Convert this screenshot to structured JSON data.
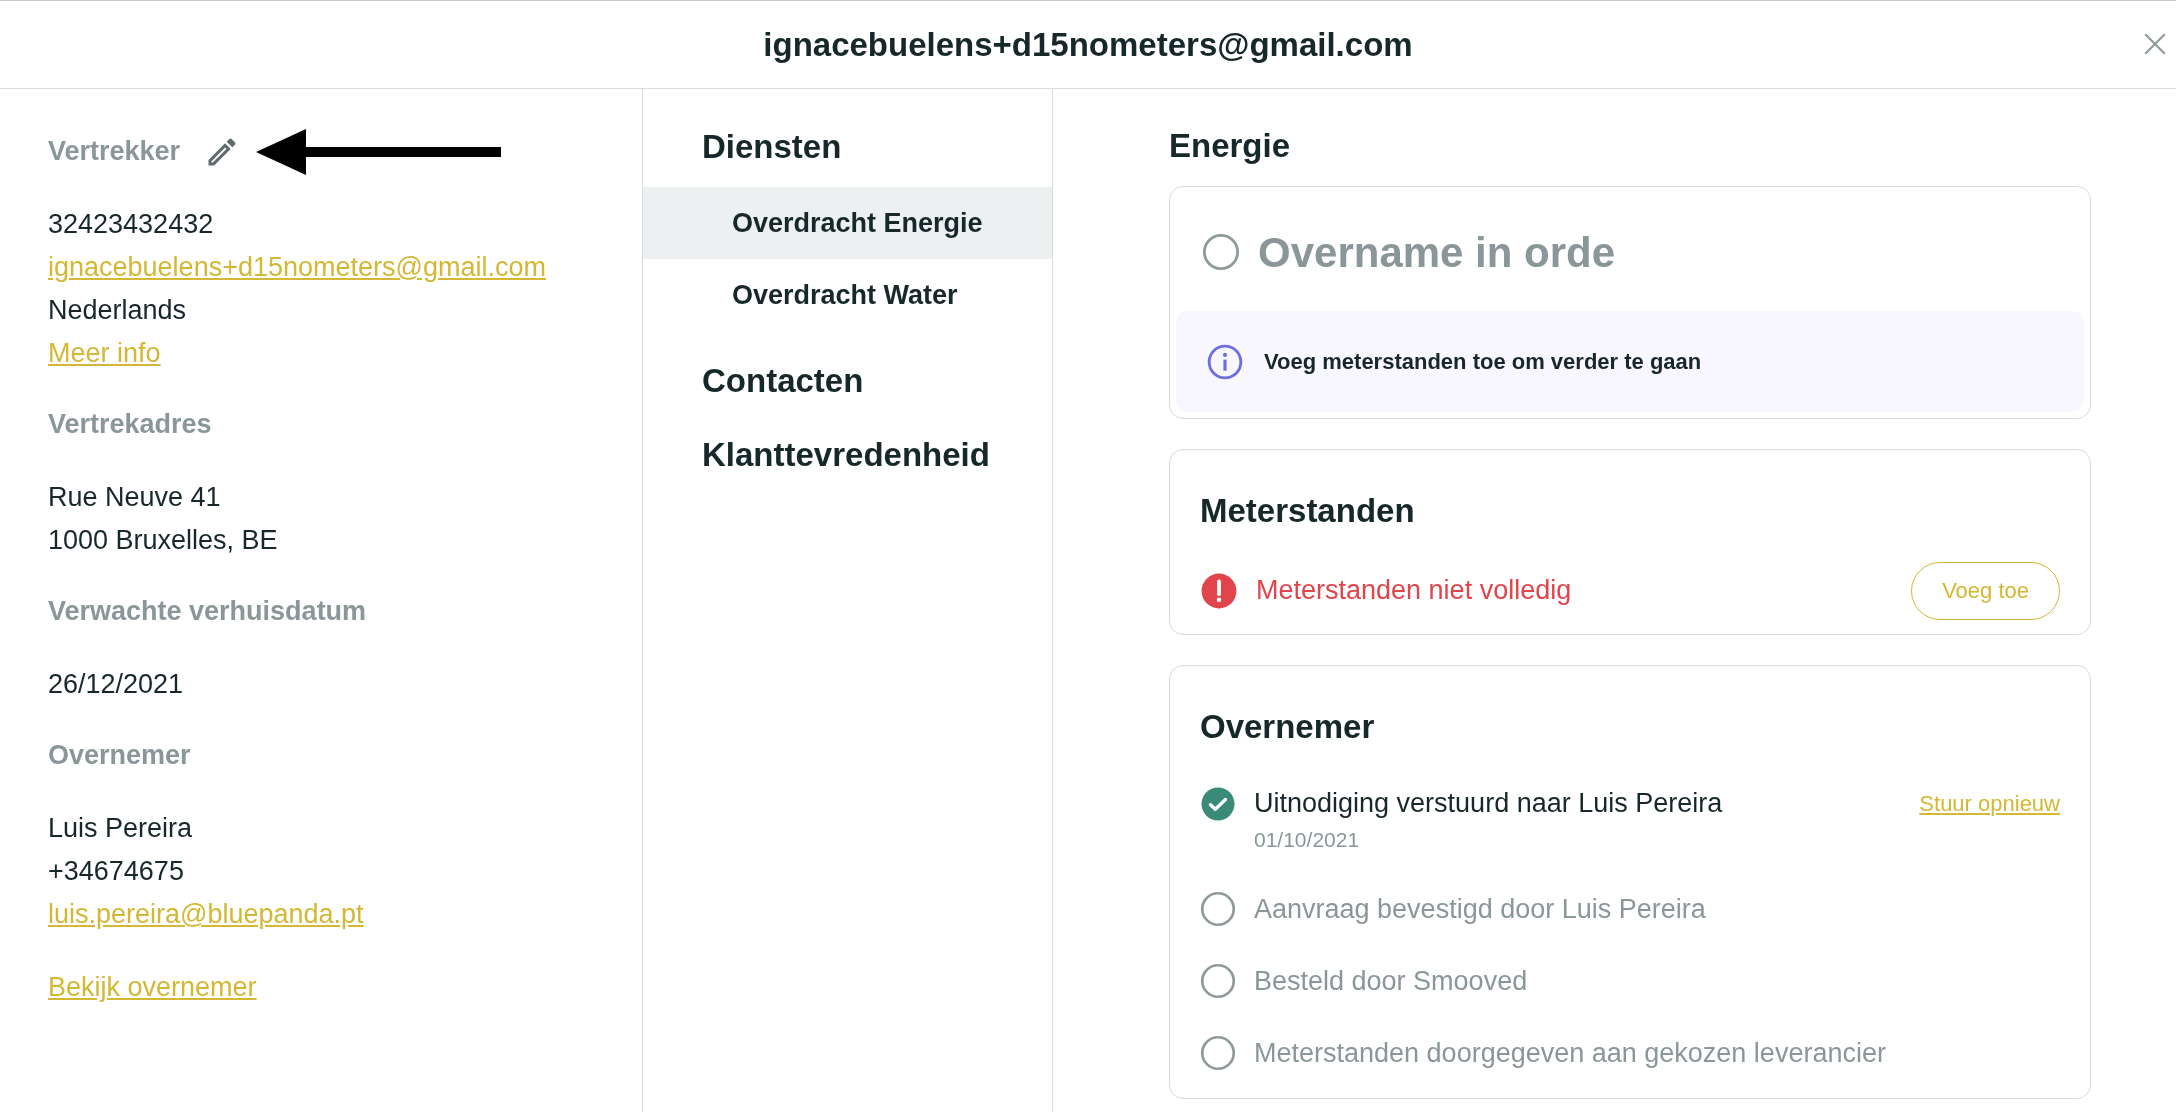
{
  "header": {
    "title": "ignacebuelens+d15nometers@gmail.com"
  },
  "contact_panel": {
    "sections": [
      {
        "heading": "Vertrekker",
        "editable": true,
        "lines": [
          {
            "kind": "text",
            "text": "32423432432"
          },
          {
            "kind": "link",
            "text": "ignacebuelens+d15nometers@gmail.com"
          },
          {
            "kind": "text",
            "text": "Nederlands"
          },
          {
            "kind": "link",
            "text": "Meer info"
          }
        ]
      },
      {
        "heading": "Vertrekadres",
        "editable": false,
        "lines": [
          {
            "kind": "text",
            "text": "Rue Neuve 41"
          },
          {
            "kind": "text",
            "text": "1000 Bruxelles, BE"
          }
        ]
      },
      {
        "heading": "Verwachte verhuisdatum",
        "editable": false,
        "lines": [
          {
            "kind": "text",
            "text": "26/12/2021"
          }
        ]
      },
      {
        "heading": "Overnemer",
        "editable": false,
        "lines": [
          {
            "kind": "text",
            "text": "Luis Pereira"
          },
          {
            "kind": "text",
            "text": "+34674675"
          },
          {
            "kind": "link",
            "text": "luis.pereira@bluepanda.pt"
          }
        ]
      }
    ],
    "footer_link": "Bekijk overnemer"
  },
  "nav": {
    "groups": [
      {
        "label": "Diensten",
        "items": [
          {
            "label": "Overdracht Energie",
            "selected": true
          },
          {
            "label": "Overdracht Water",
            "selected": false
          }
        ]
      },
      {
        "label": "Contacten"
      },
      {
        "label": "Klanttevredenheid"
      }
    ]
  },
  "content": {
    "title": "Energie",
    "status": {
      "label": "Overname in orde",
      "done": false,
      "info": "Voeg meterstanden toe om verder te gaan"
    },
    "meters": {
      "title": "Meterstanden",
      "complete": false,
      "message": "Meterstanden niet volledig",
      "button": "Voeg toe"
    },
    "overnemer": {
      "title": "Overnemer",
      "steps": [
        {
          "label": "Uitnodiging verstuurd naar Luis Pereira",
          "done": true,
          "date": "01/10/2021",
          "action": "Stuur opnieuw"
        },
        {
          "label": "Aanvraag bevestigd door Luis Pereira",
          "done": false
        },
        {
          "label": "Besteld door Smooved",
          "done": false
        },
        {
          "label": "Meterstanden doorgegeven aan gekozen leverancier",
          "done": false
        }
      ]
    }
  }
}
